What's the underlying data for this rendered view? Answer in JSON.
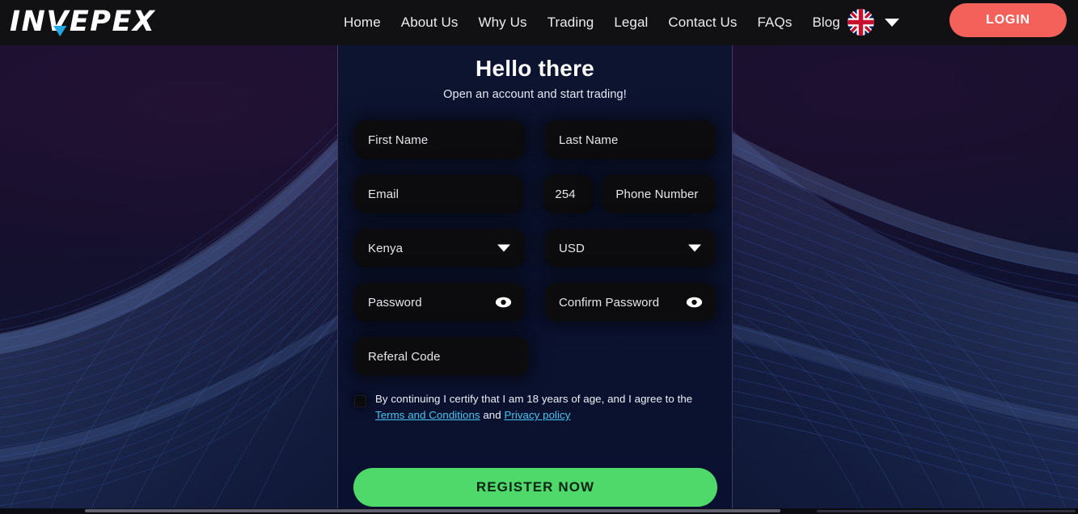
{
  "brand": {
    "name": "INVEPEX",
    "accent_color": "#22a8e0",
    "text_color": "#ffffff"
  },
  "header": {
    "background": "#111113",
    "nav_items": [
      {
        "label": "Home",
        "name": "nav-home"
      },
      {
        "label": "About Us",
        "name": "nav-about-us"
      },
      {
        "label": "Why Us",
        "name": "nav-why-us"
      },
      {
        "label": "Trading",
        "name": "nav-trading"
      },
      {
        "label": "Legal",
        "name": "nav-legal"
      },
      {
        "label": "Contact Us",
        "name": "nav-contact-us"
      },
      {
        "label": "FAQs",
        "name": "nav-faqs"
      },
      {
        "label": "Blog",
        "name": "nav-blog"
      }
    ],
    "language": {
      "flag_icon": "uk-flag-icon",
      "chevron_icon": "chevron-down-icon"
    },
    "login_label": "LOGIN",
    "login_color": "#f4615a"
  },
  "form": {
    "title": "Hello there",
    "subtitle": "Open an account and start trading!",
    "fields": {
      "first_name": "First Name",
      "last_name": "Last Name",
      "email": "Email",
      "phone_prefix": "254",
      "phone_number": "Phone Number",
      "country": "Kenya",
      "currency": "USD",
      "password": "Password",
      "confirm_password": "Confirm Password",
      "referral_code": "Referal Code"
    },
    "consent": {
      "text_before": "By continuing I certify that I am 18 years of age, and I agree to the ",
      "terms_link": "Terms and Conditions",
      "text_middle": " and ",
      "privacy_link": "Privacy policy",
      "link_color": "#48c5f0"
    },
    "submit_label": "REGISTER NOW",
    "submit_color": "#4ed96a"
  }
}
